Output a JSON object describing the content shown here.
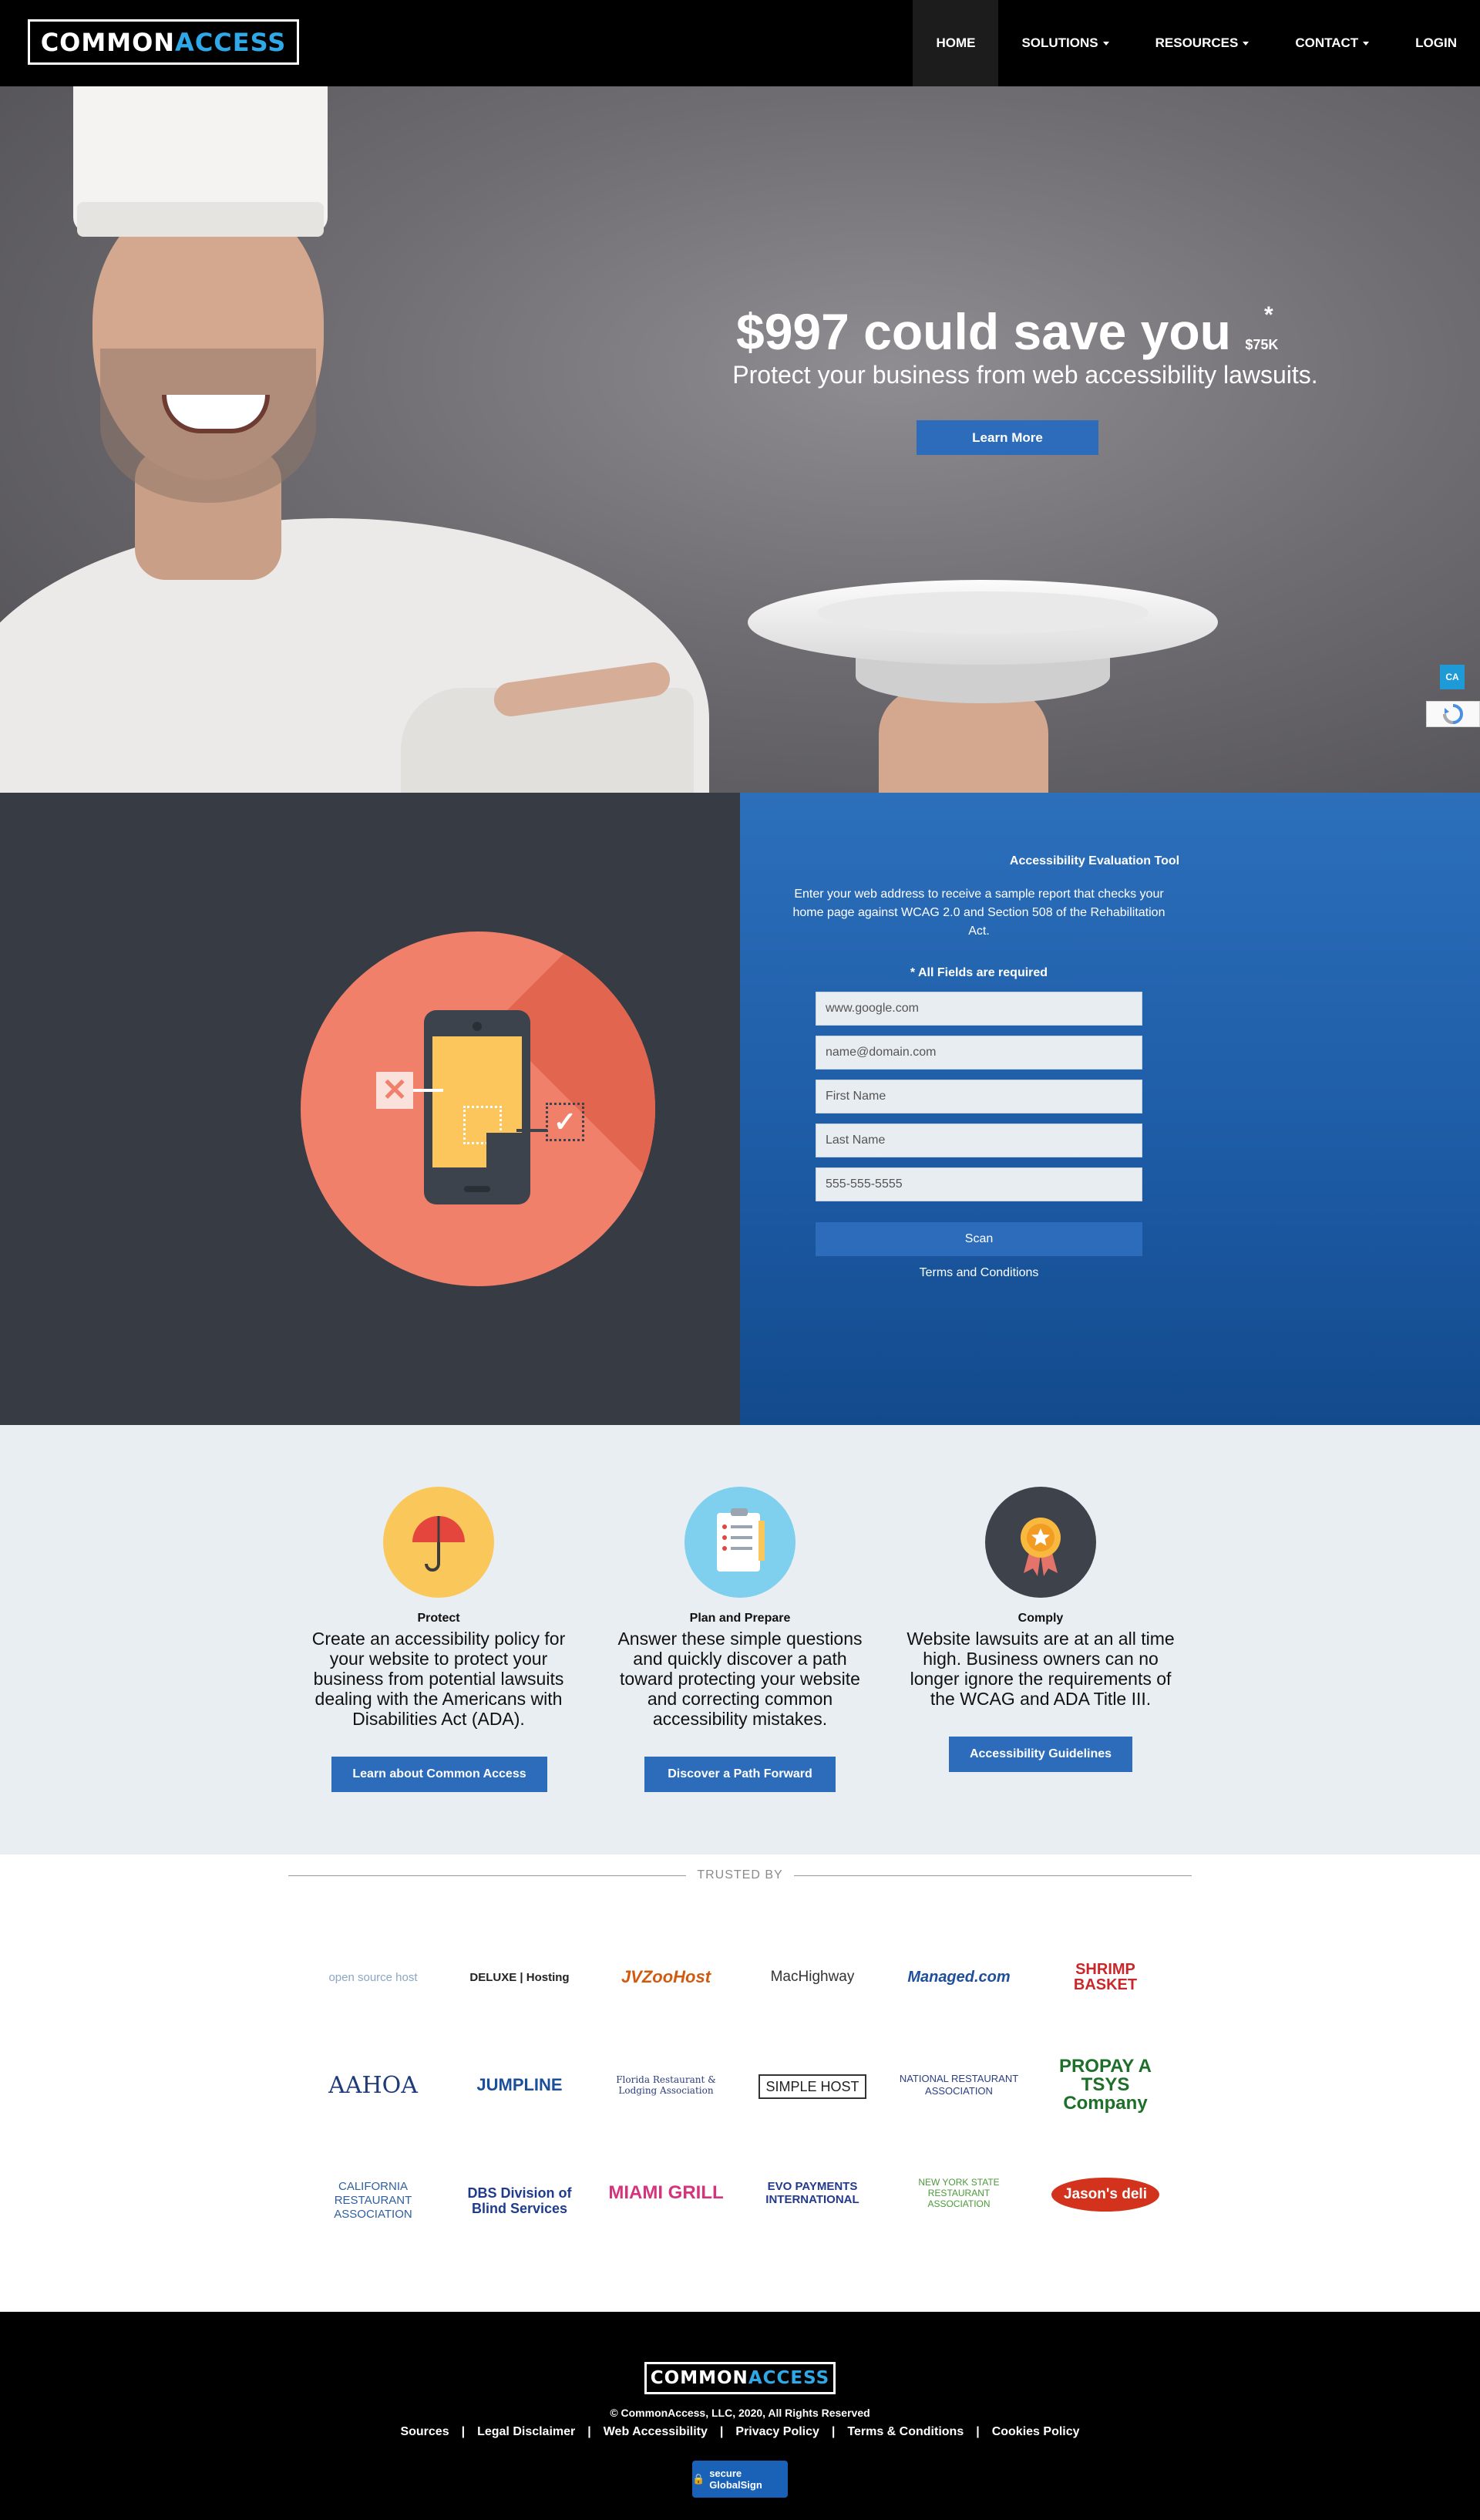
{
  "nav": {
    "logo_part1": "COMMON",
    "logo_part2": "ACCESS",
    "items": [
      {
        "label": "HOME",
        "dropdown": false,
        "active": true
      },
      {
        "label": "SOLUTIONS",
        "dropdown": true,
        "active": false
      },
      {
        "label": "RESOURCES",
        "dropdown": true,
        "active": false
      },
      {
        "label": "CONTACT",
        "dropdown": true,
        "active": false
      },
      {
        "label": "LOGIN",
        "dropdown": false,
        "active": false
      }
    ]
  },
  "hero": {
    "title_main": "$997 could save you",
    "title_small": "$75K",
    "title_star": "*",
    "subtitle": "Protect your business from web accessibility lawsuits.",
    "cta": "Learn More",
    "side_badge": "CA"
  },
  "scan": {
    "title": "Accessibility Evaluation Tool",
    "description": "Enter your web address to receive a sample report that checks your home page against WCAG 2.0 and Section 508 of the Rehabilitation Act.",
    "required_note": "* All Fields are required",
    "fields": {
      "url": "www.google.com",
      "email": "name@domain.com",
      "first_name": "First Name",
      "last_name": "Last Name",
      "phone": "555-555-5555"
    },
    "button": "Scan",
    "terms": "Terms and Conditions"
  },
  "features": [
    {
      "icon": "umbrella-icon",
      "title": "Protect",
      "text": "Create an accessibility policy for your website to protect your business from potential lawsuits dealing with the Americans with Disabilities Act (ADA).",
      "button": "Learn about Common Access"
    },
    {
      "icon": "checklist-icon",
      "title": "Plan and Prepare",
      "text": "Answer these simple questions and quickly discover a path toward protecting your website and correcting common accessibility mistakes.",
      "button": "Discover a Path Forward"
    },
    {
      "icon": "award-ribbon-icon",
      "title": "Comply",
      "text": "Website lawsuits are at an all time high. Business owners can no longer ignore the requirements of the WCAG and ADA Title III.",
      "button": "Accessibility Guidelines"
    }
  ],
  "trusted": {
    "heading": "TRUSTED BY",
    "logos": [
      "open source host",
      "DELUXE | Hosting",
      "JVZooHost",
      "MacHighway",
      "Managed.com",
      "SHRIMP BASKET",
      "AAHOA",
      "JUMPLINE",
      "Florida Restaurant & Lodging Association",
      "SIMPLE HOST",
      "NATIONAL RESTAURANT ASSOCIATION",
      "PROPAY A TSYS Company",
      "CALIFORNIA RESTAURANT ASSOCIATION",
      "DBS Division of Blind Services",
      "MIAMI GRILL",
      "EVO PAYMENTS INTERNATIONAL",
      "NEW YORK STATE RESTAURANT ASSOCIATION",
      "Jason's deli"
    ]
  },
  "footer": {
    "logo_part1": "COMMON",
    "logo_part2": "ACCESS",
    "copyright": "© CommonAccess, LLC,  2020, All Rights Reserved",
    "links": [
      "Sources",
      "Legal Disclaimer",
      "Web Accessibility",
      "Privacy Policy",
      "Terms & Conditions",
      "Cookies Policy"
    ],
    "badge": "secure GlobalSign"
  },
  "colors": {
    "accent": "#2c6cbb",
    "logo_blue": "#2fa8e8",
    "nav_bg": "#000000",
    "panel_dark": "#373b44"
  }
}
